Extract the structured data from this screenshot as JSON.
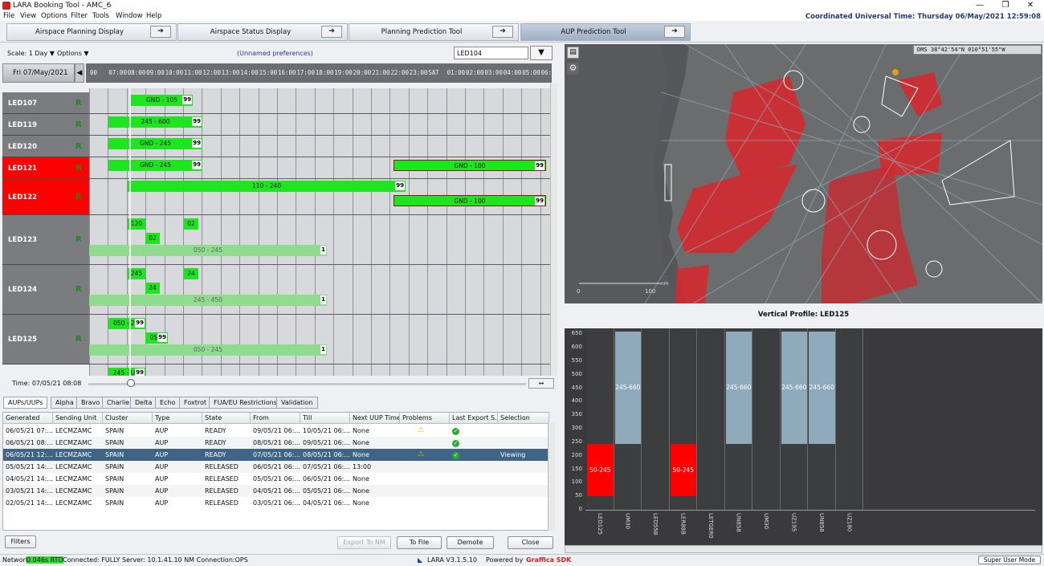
{
  "titlebar": {
    "title": "LARA Booking Tool - AMC_6",
    "minimize": "—",
    "restore": "❐",
    "close": "✕"
  },
  "menu": [
    "File",
    "View",
    "Options",
    "Filter",
    "Tools",
    "Window",
    "Help"
  ],
  "utc": "Coordinated Universal Time: Thursday 06/May/2021   12:59:08",
  "tabs": [
    "Airspace Planning Display",
    "Airspace Status Display",
    "Planning Prediction Tool",
    "AUP Prediction Tool"
  ],
  "tab_arrow": "➔",
  "options": {
    "scale": "Scale: 1 Day ▼",
    "options": "Options ▼",
    "prefs": "(Unnamed preferences)",
    "filter_value": "LED104",
    "funnel": "▼"
  },
  "timeline": {
    "date": "Fri 07/May/2021",
    "left_arrow": "◀",
    "ticks": [
      "00",
      "07:00",
      "08:00",
      "09:00",
      "10:00",
      "11:00",
      "12:00",
      "13:00",
      "14:00",
      "15:00",
      "16:00",
      "17:00",
      "18:00",
      "19:00",
      "20:00",
      "21:00",
      "22:00",
      "23:00",
      "SAT",
      "01:00",
      "02:00",
      "03:00",
      "04:00",
      "05:00",
      "06:00"
    ]
  },
  "rows": [
    {
      "name": "LED107",
      "mark": "R",
      "red": false,
      "bars": [
        {
          "label": "GND - 105",
          "n": "99"
        }
      ]
    },
    {
      "name": "LED119",
      "mark": "R",
      "red": false,
      "bars": [
        {
          "label": "245 - 600",
          "n": "99"
        }
      ]
    },
    {
      "name": "LED120",
      "mark": "R",
      "red": false,
      "bars": [
        {
          "label": "GND - 245",
          "n": "99"
        }
      ]
    },
    {
      "name": "LED121",
      "mark": "R",
      "red": true,
      "bars": [
        {
          "label": "GND - 245",
          "n": "99"
        },
        {
          "label": "GND - 100",
          "n": "99"
        }
      ]
    },
    {
      "name": "LED122",
      "mark": "R",
      "red": true,
      "bars": [
        {
          "label": "110 - 240",
          "n": "99"
        },
        {
          "label": "GND - 100",
          "n": "99"
        }
      ]
    },
    {
      "name": "LED123",
      "mark": "R",
      "red": false,
      "bars": [
        {
          "label": "120",
          "n": ""
        },
        {
          "label": "02",
          "n": ""
        },
        {
          "label": "02",
          "n": ""
        },
        {
          "label": "050 - 245",
          "n": "1"
        }
      ]
    },
    {
      "name": "LED124",
      "mark": "R",
      "red": false,
      "bars": [
        {
          "label": "245",
          "n": ""
        },
        {
          "label": "24",
          "n": ""
        },
        {
          "label": "24",
          "n": ""
        },
        {
          "label": "245 - 450",
          "n": "1"
        }
      ]
    },
    {
      "name": "LED125",
      "mark": "R",
      "red": false,
      "bars": [
        {
          "label": "050 - 2...",
          "n": "99"
        },
        {
          "label": "05...",
          "n": "99"
        },
        {
          "label": "050 - 245",
          "n": "1"
        }
      ]
    },
    {
      "name": "",
      "mark": "",
      "red": false,
      "bars": [
        {
          "label": "245 - U...",
          "n": "99"
        }
      ]
    }
  ],
  "time_label": "Time: 07/05/21 08:08",
  "time_arrows": "↔",
  "bottom_tabs": [
    "AUPs/UUPs",
    "Alpha",
    "Bravo",
    "Charlie",
    "Delta",
    "Echo",
    "Foxtrot",
    "FUA/EU Restrictions",
    "Validation"
  ],
  "table": {
    "headers": [
      "Generated",
      "Sending Unit",
      "Cluster",
      "Type",
      "State",
      "From",
      "Till",
      "Next UUP Time",
      "Problems",
      "Last Export S...",
      "Selection"
    ],
    "rows": [
      [
        "06/05/21 07:...",
        "LECMZAMC",
        "SPAIN",
        "AUP",
        "READY",
        "09/05/21 06:...",
        "10/05/21 06:...",
        "None",
        "⚠",
        "✓",
        ""
      ],
      [
        "06/05/21 08:...",
        "LECMZAMC",
        "SPAIN",
        "AUP",
        "READY",
        "08/05/21 06:...",
        "09/05/21 06:...",
        "None",
        "",
        "✓",
        ""
      ],
      [
        "06/05/21 12:...",
        "LECMZAMC",
        "SPAIN",
        "AUP",
        "READY",
        "07/05/21 06:...",
        "08/05/21 06:...",
        "None",
        "⚠",
        "✓",
        "Viewing"
      ],
      [
        "05/05/21 14:...",
        "LECMZAMC",
        "SPAIN",
        "AUP",
        "RELEASED",
        "06/05/21 06:...",
        "07/05/21 06:...",
        "13:00",
        "",
        "",
        ""
      ],
      [
        "04/05/21 14:...",
        "LECMZAMC",
        "SPAIN",
        "AUP",
        "RELEASED",
        "05/05/21 06:...",
        "06/05/21 06:...",
        "None",
        "",
        "",
        ""
      ],
      [
        "03/05/21 14:...",
        "LECMZAMC",
        "SPAIN",
        "AUP",
        "RELEASED",
        "04/05/21 06:...",
        "05/05/21 06:...",
        "None",
        "",
        "",
        ""
      ],
      [
        "02/05/21 14:...",
        "LECMZAMC",
        "SPAIN",
        "AUP",
        "RELEASED",
        "03/05/21 06:...",
        "04/05/21 06:...",
        "None",
        "",
        "",
        ""
      ]
    ],
    "selected_row": 2
  },
  "buttons": {
    "filters": "Filters",
    "export": "Export To NM",
    "tofile": "To File",
    "demote": "Demote",
    "close": "Close"
  },
  "status": {
    "network": "Network",
    "rtd": "0.046s RTD",
    "conn": "Connected: FULLY Server: 10.1.41.10 NM Connection:OPS",
    "version": "LARA V3.1.5.10",
    "powered": "Powered by",
    "sdk": "Graffica SDK",
    "superuser": "Super User Mode"
  },
  "map": {
    "dms": "DMS   38°42'54\"N 010°51'55\"W",
    "scale_0": "0",
    "scale_100": "100",
    "scale_unit": "nm"
  },
  "vertical_profile": {
    "title": "Vertical Profile: LED125",
    "yticks": [
      "650",
      "600",
      "550",
      "500",
      "450",
      "400",
      "350",
      "300",
      "250",
      "200",
      "150",
      "100",
      "50",
      "0"
    ],
    "columns": [
      {
        "name": "LED125",
        "fill": "red",
        "label": "50-245"
      },
      {
        "name": "UM30",
        "fill": "blue",
        "label": "245-660"
      },
      {
        "name": "LED55B",
        "fill": "none",
        "label": ""
      },
      {
        "name": "LER88B",
        "fill": "red",
        "label": "50-245"
      },
      {
        "name": "LETGER0",
        "fill": "none",
        "label": ""
      },
      {
        "name": "UN858",
        "fill": "blue",
        "label": "245-660"
      },
      {
        "name": "UM30",
        "fill": "none",
        "label": ""
      },
      {
        "name": "UZ195",
        "fill": "blue",
        "label": "245-660"
      },
      {
        "name": "UN858",
        "fill": "blue",
        "label": "245-660"
      },
      {
        "name": "UZ180",
        "fill": "none",
        "label": ""
      }
    ]
  },
  "colors": {
    "accent": "#233a7a",
    "booking_green": "#1ee61e",
    "alert_red": "#ff0000",
    "profile_blue": "#8eaabb",
    "selected_row": "#3f6485"
  }
}
